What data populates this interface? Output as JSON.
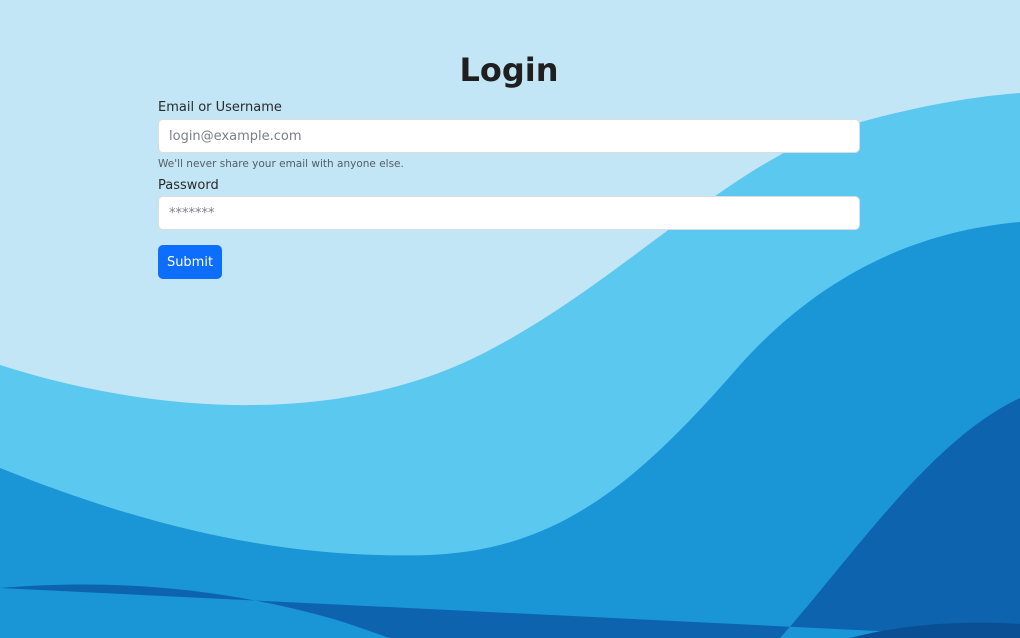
{
  "login": {
    "title": "Login",
    "email_label": "Email or Username",
    "email_placeholder": "login@example.com",
    "email_help": "We'll never share your email with anyone else.",
    "password_label": "Password",
    "password_placeholder": "*******",
    "submit_label": "Submit"
  },
  "colors": {
    "background": "#c3e6f6",
    "wave_light": "#5bc8ef",
    "wave_mid": "#1a95d6",
    "wave_dark": "#0d63ad",
    "button": "#0d6efd"
  }
}
